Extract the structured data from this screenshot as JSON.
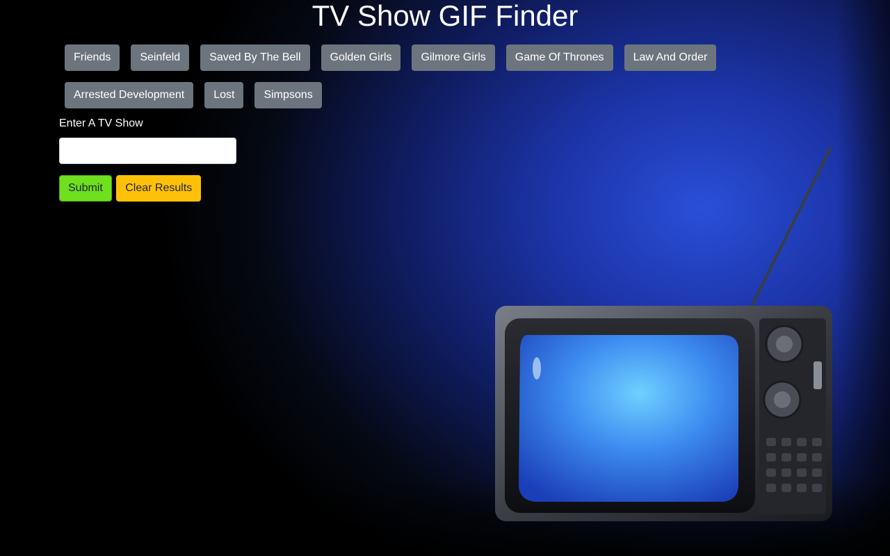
{
  "page": {
    "title": "TV Show GIF Finder"
  },
  "show_buttons": [
    "Friends",
    "Seinfeld",
    "Saved By The Bell",
    "Golden Girls",
    "Gilmore Girls",
    "Game Of Thrones",
    "Law And Order",
    "Arrested Development",
    "Lost",
    "Simpsons"
  ],
  "form": {
    "label": "Enter A TV Show",
    "input_value": "",
    "input_placeholder": "",
    "submit_label": "Submit",
    "clear_label": "Clear Results"
  },
  "colors": {
    "show_button_bg": "#6c757d",
    "submit_bg": "#6ee01e",
    "clear_bg": "#ffc107",
    "background_accent": "#2a4fd8"
  },
  "background_image": {
    "icon": "retro-tv-illustration"
  }
}
